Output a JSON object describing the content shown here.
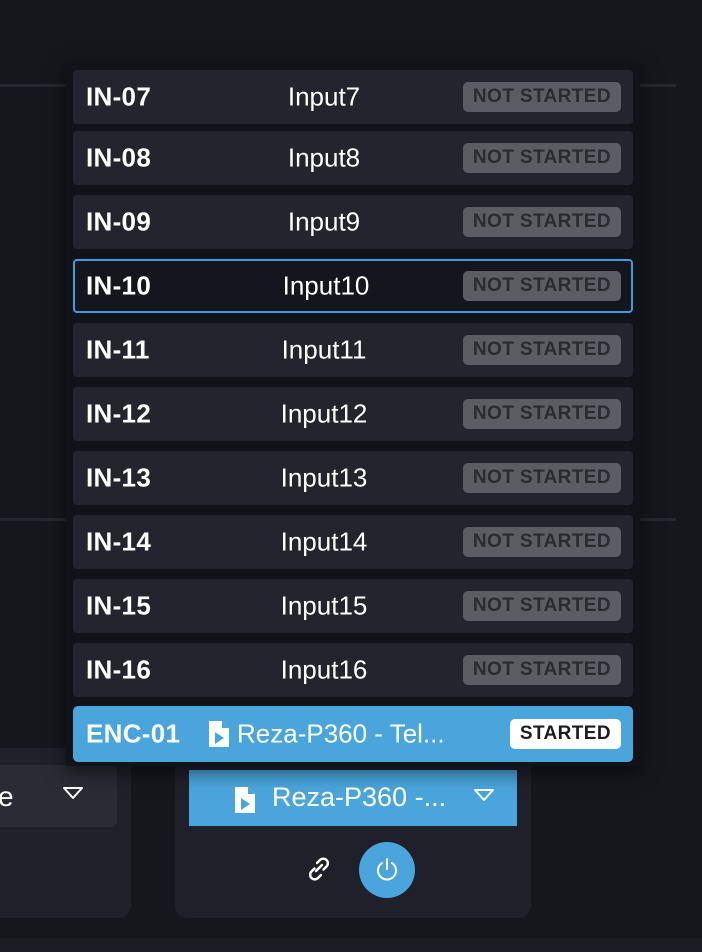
{
  "dropdown": {
    "rows": [
      {
        "id": "IN-07",
        "name": "Input7",
        "status": "NOT STARTED"
      },
      {
        "id": "IN-08",
        "name": "Input8",
        "status": "NOT STARTED"
      },
      {
        "id": "IN-09",
        "name": "Input9",
        "status": "NOT STARTED"
      },
      {
        "id": "IN-10",
        "name": "Input10",
        "status": "NOT STARTED"
      },
      {
        "id": "IN-11",
        "name": "Input11",
        "status": "NOT STARTED"
      },
      {
        "id": "IN-12",
        "name": "Input12",
        "status": "NOT STARTED"
      },
      {
        "id": "IN-13",
        "name": "Input13",
        "status": "NOT STARTED"
      },
      {
        "id": "IN-14",
        "name": "Input14",
        "status": "NOT STARTED"
      },
      {
        "id": "IN-15",
        "name": "Input15",
        "status": "NOT STARTED"
      },
      {
        "id": "IN-16",
        "name": "Input16",
        "status": "NOT STARTED"
      },
      {
        "id": "ENC-01",
        "name": "Reza-P360 - Tel...",
        "status": "STARTED",
        "icon": "document-play-icon"
      }
    ]
  },
  "left_panel": {
    "select_text": "e",
    "caret_icon": "chevron-down-icon"
  },
  "right_panel": {
    "select_text": "Reza-P360 -...",
    "select_icon": "document-play-icon",
    "caret_icon": "chevron-down-icon",
    "link_icon": "link-icon",
    "power_icon": "power-icon"
  },
  "colors": {
    "background": "#16171d",
    "row": "#23242d",
    "selected_border": "#3f9cdc",
    "accent": "#4aa5dc",
    "badge": "#5b5c64",
    "badge_text": "#2a2b31"
  }
}
